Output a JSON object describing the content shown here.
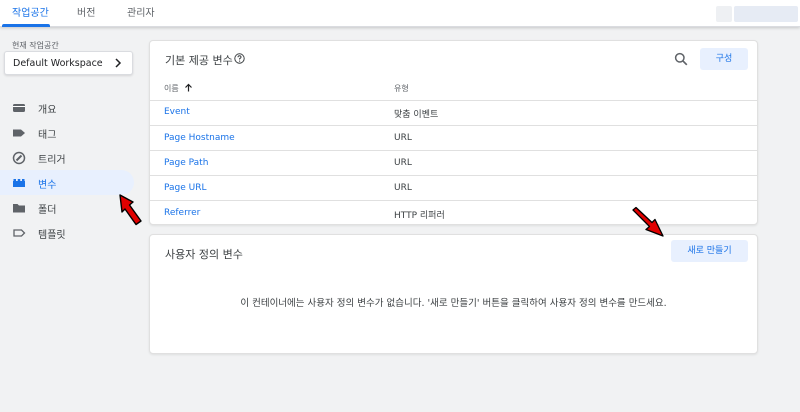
{
  "tabs": [
    {
      "label": "작업공간",
      "active": true
    },
    {
      "label": "버전",
      "active": false
    },
    {
      "label": "관리자",
      "active": false
    }
  ],
  "workspace": {
    "label": "현재 작업공간",
    "value": "Default Workspace"
  },
  "sidebar": {
    "items": [
      {
        "label": "개요",
        "icon": "overview-icon",
        "active": false
      },
      {
        "label": "태그",
        "icon": "tag-icon",
        "active": false
      },
      {
        "label": "트리거",
        "icon": "trigger-icon",
        "active": false
      },
      {
        "label": "변수",
        "icon": "variables-icon",
        "active": true
      },
      {
        "label": "폴더",
        "icon": "folder-icon",
        "active": false
      },
      {
        "label": "템플릿",
        "icon": "template-icon",
        "active": false
      }
    ]
  },
  "builtin": {
    "title": "기본 제공 변수",
    "config_button": "구성",
    "columns": {
      "name": "이름",
      "type": "유형"
    },
    "rows": [
      {
        "name": "Event",
        "type": "맞춤 이벤트"
      },
      {
        "name": "Page Hostname",
        "type": "URL"
      },
      {
        "name": "Page Path",
        "type": "URL"
      },
      {
        "name": "Page URL",
        "type": "URL"
      },
      {
        "name": "Referrer",
        "type": "HTTP 리퍼러"
      }
    ]
  },
  "user_defined": {
    "title": "사용자 정의 변수",
    "new_button": "새로 만들기",
    "empty_message": "이 컨테이너에는 사용자 정의 변수가 없습니다. '새로 만들기' 버튼을 클릭하여 사용자 정의 변수를 만드세요."
  },
  "colors": {
    "accent": "#1a73e8",
    "active_bg": "#e8f0fe",
    "annotation": "#e00000"
  }
}
